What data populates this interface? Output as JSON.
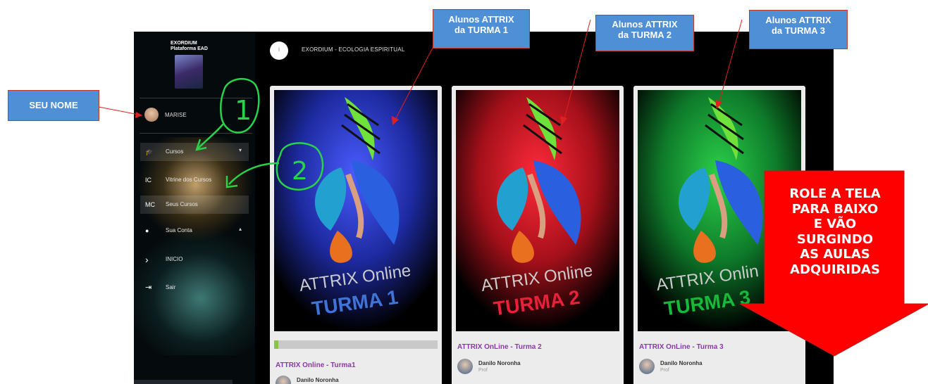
{
  "sidebar": {
    "logo_line1": "EXORDIUM",
    "logo_line2": "Plataforma EAD",
    "user_name": "MARISE",
    "items": [
      {
        "icon": "graduation-cap-icon",
        "glyph": "🎓",
        "label": "Cursos",
        "caret": "▾"
      },
      {
        "icon": "initials-ic",
        "glyph": "IC",
        "label": "Vitrine dos Cursos",
        "caret": ""
      },
      {
        "icon": "initials-mc",
        "glyph": "MC",
        "label": "Seus Cursos",
        "caret": ""
      },
      {
        "icon": "user-icon",
        "glyph": "●",
        "label": "Sua Conta",
        "caret": "▴"
      },
      {
        "icon": "chevron-right-icon",
        "glyph": "›",
        "label": "INICIO",
        "caret": ""
      },
      {
        "icon": "logout-icon",
        "glyph": "⇥",
        "label": "Sair",
        "caret": ""
      }
    ]
  },
  "header": {
    "title": "EXORDIUM - ECOLOGIA ESPIRITUAL",
    "info_glyph": "i"
  },
  "courses": [
    {
      "image_title": "ATTRIX Online",
      "image_subtitle": "TURMA 1",
      "subtitle_color": "#3f74d6",
      "bg_color": "#2233a8",
      "title": "ATTRIX Online - Turma1",
      "author": "Danilo Noronha",
      "role": "",
      "progress": 0.025
    },
    {
      "image_title": "ATTRIX Online",
      "image_subtitle": "TURMA 2",
      "subtitle_color": "#e8213a",
      "bg_color": "#b0101a",
      "title": "ATTRIX OnLine - Turma 2",
      "author": "Danilo Noronha",
      "role": "Prof",
      "progress": null
    },
    {
      "image_title": "ATTRIX Onlin",
      "image_subtitle": "TURMA 3",
      "subtitle_color": "#18b83a",
      "bg_color": "#0e7a2a",
      "title": "ATTRIX OnLine - Turma 3",
      "author": "Danilo Noronha",
      "role": "Prof",
      "progress": null
    }
  ],
  "annotations": {
    "seu_nome": "SEU NOME",
    "turma1_line1": "Alunos ATTRIX",
    "turma1_line2": "da TURMA 1",
    "turma2_line1": "Alunos ATTRIX",
    "turma2_line2": "da TURMA 2",
    "turma3_line1": "Alunos ATTRIX",
    "turma3_line2": "da TURMA 3",
    "step1": "1",
    "step2": "2",
    "scroll_lines": [
      "ROLE A TELA",
      "PARA BAIXO",
      "E VÃO",
      "SURGINDO",
      "AS AULAS",
      "ADQUIRIDAS"
    ]
  },
  "colors": {
    "callout_bg": "#4f8fd6",
    "arrow_red": "#ff0000",
    "annotation_green": "#28d24a",
    "course_title": "#8a3aa8"
  }
}
